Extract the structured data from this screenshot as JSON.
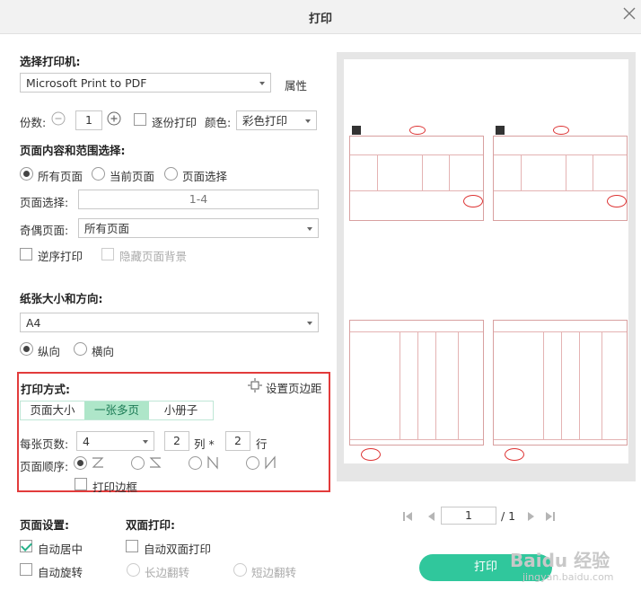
{
  "dialog": {
    "title": "打印"
  },
  "printer": {
    "section_label": "选择打印机:",
    "selected": "Microsoft Print to PDF",
    "properties_label": "属性"
  },
  "copies": {
    "label": "份数:",
    "value": "1",
    "collate_label": "逐份打印",
    "color_label": "颜色:",
    "color_value": "彩色打印"
  },
  "range": {
    "section_label": "页面内容和范围选择:",
    "options": [
      "所有页面",
      "当前页面",
      "页面选择"
    ],
    "selected_index": 0,
    "page_select_label": "页面选择:",
    "page_select_value": "1-4",
    "odd_even_label": "奇偶页面:",
    "odd_even_value": "所有页面",
    "reverse_label": "逆序打印",
    "hide_bg_label": "隐藏页面背景"
  },
  "paper": {
    "section_label": "纸张大小和方向:",
    "size": "A4",
    "orientation_options": [
      "纵向",
      "横向"
    ],
    "orientation_selected": 0
  },
  "print_mode": {
    "section_label": "打印方式:",
    "margin_label": "设置页边距",
    "tabs": [
      "页面大小",
      "一张多页",
      "小册子"
    ],
    "active_tab": 1,
    "per_sheet_label": "每张页数:",
    "per_sheet_value": "4",
    "columns_value": "2",
    "columns_label": "列 *",
    "rows_value": "2",
    "rows_label": "行",
    "order_label": "页面顺序:",
    "order_selected": 0,
    "border_label": "打印边框"
  },
  "page_settings": {
    "section_label": "页面设置:",
    "auto_center_label": "自动居中",
    "auto_center_checked": true,
    "auto_rotate_label": "自动旋转"
  },
  "duplex": {
    "section_label": "双面打印:",
    "auto_duplex_label": "自动双面打印",
    "long_edge_label": "长边翻转",
    "short_edge_label": "短边翻转"
  },
  "preview_nav": {
    "current_page": "1",
    "total_pages": "/ 1"
  },
  "print_button": {
    "label": "打印"
  },
  "watermark": {
    "text": "Baidu 经验",
    "sub": "jingyan.baidu.com"
  },
  "colors": {
    "accent": "#30c79c",
    "highlight": "#e23b3b",
    "tab_active": "#aee6c9"
  }
}
